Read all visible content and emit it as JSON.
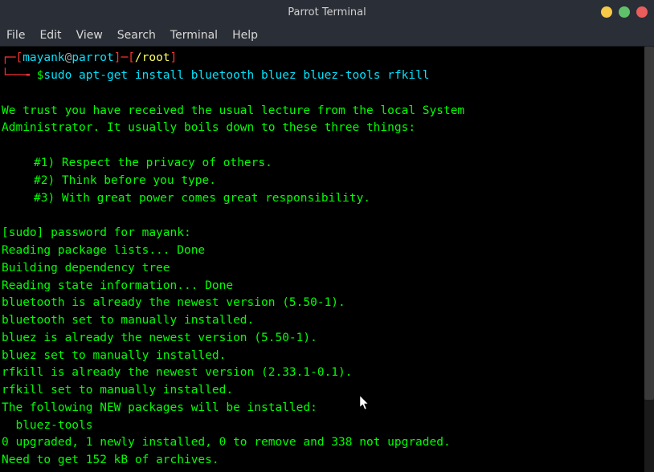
{
  "window": {
    "title": "Parrot Terminal"
  },
  "menu": {
    "file": "File",
    "edit": "Edit",
    "view": "View",
    "search": "Search",
    "terminal": "Terminal",
    "help": "Help"
  },
  "prompt": {
    "lbracket1": "┌─[",
    "user": "mayank",
    "at": "@",
    "host": "parrot",
    "rbracket_dash": "]─[",
    "path": "/root",
    "rbracket2": "]",
    "line2_prefix": "└──╼ ",
    "dollar": "$",
    "command": "sudo apt-get install bluetooth bluez bluez-tools rfkill"
  },
  "output": {
    "l1": "We trust you have received the usual lecture from the local System",
    "l2": "Administrator. It usually boils down to these three things:",
    "r1": "#1) Respect the privacy of others.",
    "r2": "#2) Think before you type.",
    "r3": "#3) With great power comes great responsibility.",
    "l3": "[sudo] password for mayank:",
    "l4": "Reading package lists... Done",
    "l5": "Building dependency tree",
    "l6": "Reading state information... Done",
    "l7": "bluetooth is already the newest version (5.50-1).",
    "l8": "bluetooth set to manually installed.",
    "l9": "bluez is already the newest version (5.50-1).",
    "l10": "bluez set to manually installed.",
    "l11": "rfkill is already the newest version (2.33.1-0.1).",
    "l12": "rfkill set to manually installed.",
    "l13": "The following NEW packages will be installed:",
    "l14": "  bluez-tools",
    "l15": "0 upgraded, 1 newly installed, 0 to remove and 338 not upgraded.",
    "l16": "Need to get 152 kB of archives."
  }
}
